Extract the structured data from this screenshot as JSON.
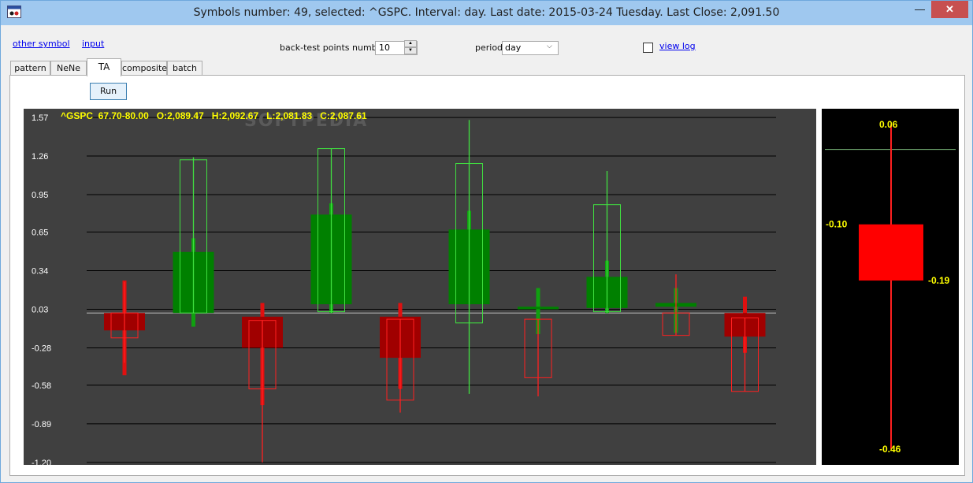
{
  "window": {
    "title": "Symbols number: 49, selected:  ^GSPC. Interval: day.  Last date: 2015-03-24 Tuesday.  Last Close: 2,091.50",
    "minimize_glyph": "—",
    "maximize_glyph": "☐",
    "close_glyph": "✕",
    "icon": "chart-app-icon"
  },
  "toolbar": {
    "other_symbol_link": "other symbol",
    "input_link": "input",
    "backtest_label": "back-test points number",
    "backtest_value": "10",
    "period_label": "period",
    "period_value": "day",
    "view_log_link": "view log",
    "view_log_checked": false
  },
  "tabs": [
    {
      "label": "pattern",
      "selected": false
    },
    {
      "label": "NeNe",
      "selected": false
    },
    {
      "label": "TA",
      "selected": true
    },
    {
      "label": "composite",
      "selected": false
    },
    {
      "label": "batch",
      "selected": false
    }
  ],
  "run_button": "Run",
  "chart_data": [
    {
      "type": "candlestick",
      "header": "^GSPC  67.70-80.00   O:2,089.47   H:2,092.67   L:2,081.83   C:2,087.61",
      "watermark": "SOFTPEDIA",
      "ylim": [
        -1.22,
        1.64
      ],
      "yticks": [
        1.57,
        1.26,
        0.95,
        0.65,
        0.34,
        0.03,
        -0.28,
        -0.58,
        -0.89,
        -1.2
      ],
      "ytick_labels": [
        "1.57",
        "1.26",
        "0.95",
        "0.65",
        "0.34",
        "0.03",
        "-0.28",
        "-0.58",
        "-0.89",
        "-1.20"
      ],
      "zero_line": 0.0,
      "grid": true,
      "background": "#404040",
      "colors": {
        "up": "#008000",
        "down": "#a00000",
        "up_outline": "#40e040",
        "down_outline": "#ff2020",
        "text": "#ffff00"
      },
      "candles": [
        {
          "kind": "down",
          "open": 0.0,
          "close": -0.14,
          "high": 0.26,
          "low": -0.5
        },
        {
          "kind": "up",
          "open": 0.0,
          "close": 0.49,
          "high": 0.6,
          "low": -0.11
        },
        {
          "kind": "down",
          "open": -0.03,
          "close": -0.28,
          "high": 0.08,
          "low": -0.74
        },
        {
          "kind": "up",
          "open": 0.07,
          "close": 0.79,
          "high": 0.88,
          "low": 0.0
        },
        {
          "kind": "down",
          "open": -0.03,
          "close": -0.36,
          "high": 0.08,
          "low": -0.61
        },
        {
          "kind": "up",
          "open": 0.07,
          "close": 0.67,
          "high": 0.82,
          "low": null
        },
        {
          "kind": "up",
          "open": 0.03,
          "close": 0.05,
          "high": 0.2,
          "low": -0.17
        },
        {
          "kind": "up",
          "open": 0.04,
          "close": 0.29,
          "high": 0.42,
          "low": 0.0
        },
        {
          "kind": "up",
          "open": 0.05,
          "close": 0.08,
          "high": 0.2,
          "low": -0.16
        },
        {
          "kind": "down",
          "open": 0.0,
          "close": -0.19,
          "high": 0.13,
          "low": -0.32
        }
      ],
      "outlines": [
        {
          "kind": "down",
          "open": 0.0,
          "close": -0.2,
          "high": 0.25,
          "low": -0.4
        },
        {
          "kind": "up",
          "open": 0.0,
          "close": 1.23,
          "high": 1.25,
          "low": 0.0
        },
        {
          "kind": "down",
          "open": -0.06,
          "close": -0.61,
          "high": -0.06,
          "low": -1.2
        },
        {
          "kind": "up",
          "open": 0.01,
          "close": 1.32,
          "high": 1.32,
          "low": 0.0
        },
        {
          "kind": "down",
          "open": -0.05,
          "close": -0.7,
          "high": -0.05,
          "low": -0.8
        },
        {
          "kind": "up",
          "open": -0.08,
          "close": 1.2,
          "high": 1.55,
          "low": -0.65
        },
        {
          "kind": "down",
          "open": -0.05,
          "close": -0.52,
          "high": -0.05,
          "low": -0.67
        },
        {
          "kind": "up",
          "open": 0.01,
          "close": 0.87,
          "high": 1.14,
          "low": 0.0
        },
        {
          "kind": "down",
          "open": 0.0,
          "close": -0.18,
          "high": 0.31,
          "low": -0.18
        },
        {
          "kind": "down",
          "open": -0.04,
          "close": -0.63,
          "high": -0.04,
          "low": -0.63
        }
      ]
    },
    {
      "type": "candlestick",
      "ylim": [
        -0.47,
        0.07
      ],
      "candle": {
        "kind": "down",
        "high": 0.06,
        "open": -0.1,
        "close": -0.19,
        "low": -0.46
      },
      "reference_line": 0.02,
      "labels": {
        "high": "0.06",
        "open": "-0.10",
        "close": "-0.19",
        "low": "-0.46"
      },
      "background": "#000000",
      "colors": {
        "body": "#ff0000",
        "wick": "#ff2020",
        "text": "#ffff00",
        "ref": "#80c080"
      }
    }
  ]
}
